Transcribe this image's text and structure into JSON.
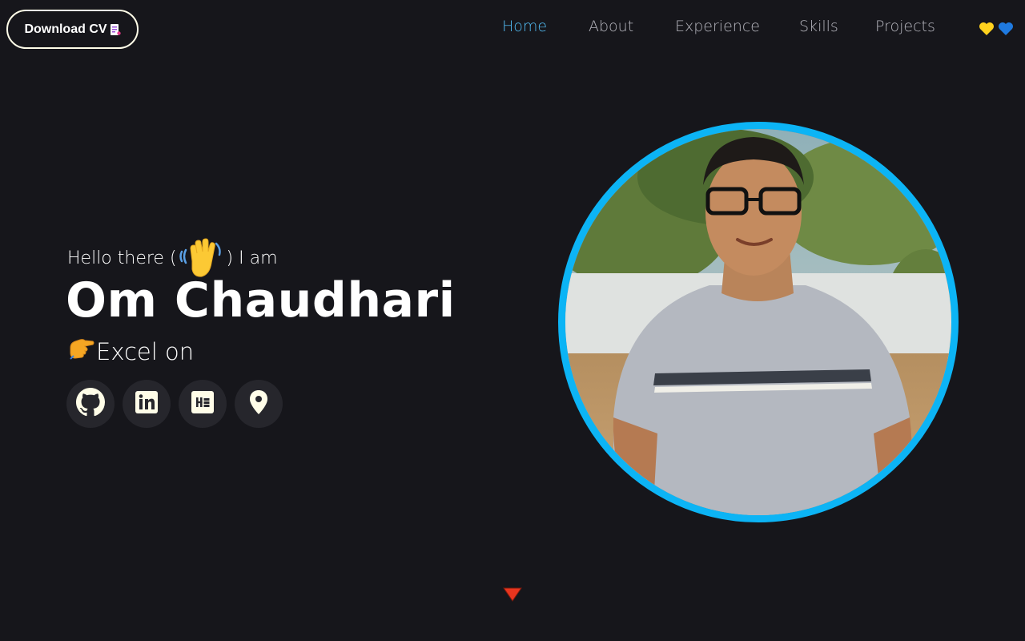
{
  "header": {
    "cv_button_label": "Download CV",
    "nav": [
      {
        "label": "Home",
        "active": true
      },
      {
        "label": "About",
        "active": false
      },
      {
        "label": "Experience",
        "active": false
      },
      {
        "label": "Skills",
        "active": false
      },
      {
        "label": "Projects",
        "active": false
      }
    ],
    "hearts": [
      "yellow-heart-icon",
      "blue-heart-icon"
    ]
  },
  "hero": {
    "greeting_before": "Hello there (",
    "greeting_after": ") I am",
    "name": "Om Chaudhari",
    "tagline": "Excel on",
    "socials": [
      "github-icon",
      "linkedin-icon",
      "hashnode-icon",
      "location-pin-icon"
    ]
  },
  "colors": {
    "background": "#16161b",
    "accent": "#51b9f0",
    "portrait_ring": "#0cb4f5",
    "social_bg": "#26262c",
    "icon_fill": "#fffde8",
    "scroll_arrow": "#e8351e"
  }
}
